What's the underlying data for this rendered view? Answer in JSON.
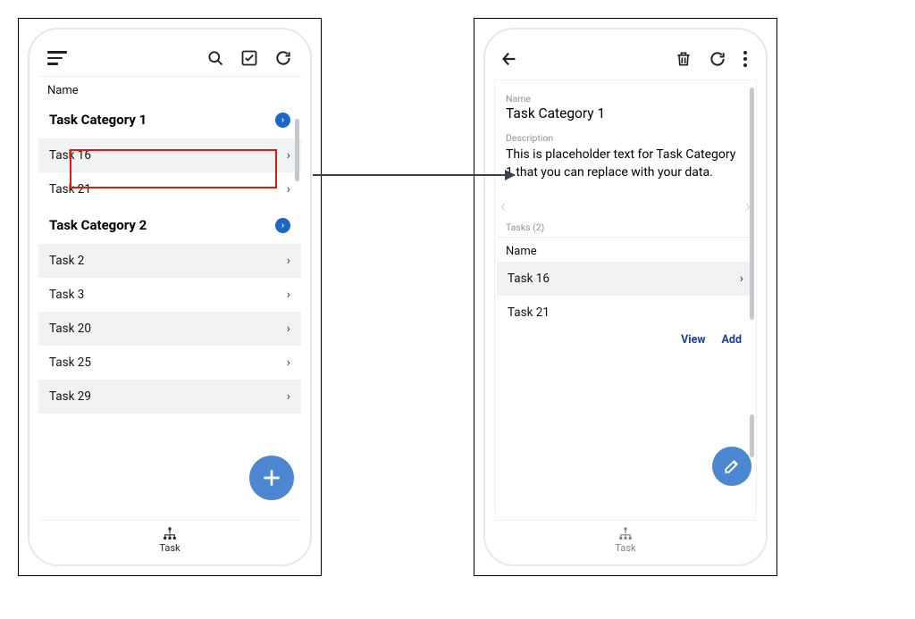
{
  "left": {
    "column_header": "Name",
    "categories": [
      {
        "label": "Task Category 1"
      },
      {
        "label": "Task Category 2"
      }
    ],
    "rows_cat1": [
      {
        "label": "Task 16"
      },
      {
        "label": "Task 21"
      }
    ],
    "rows_cat2": [
      {
        "label": "Task 2"
      },
      {
        "label": "Task 3"
      },
      {
        "label": "Task 20"
      },
      {
        "label": "Task 25"
      },
      {
        "label": "Task 29"
      }
    ],
    "bottom_tab": "Task"
  },
  "right": {
    "name_label": "Name",
    "name_value": "Task Category 1",
    "desc_label": "Description",
    "desc_value": "This is placeholder text for Task Category 1 that you can replace with your data.",
    "tasks_tab": "Tasks (2)",
    "column_header": "Name",
    "rows": [
      {
        "label": "Task 16"
      },
      {
        "label": "Task 21"
      }
    ],
    "view_label": "View",
    "add_label": "Add",
    "bottom_tab": "Task"
  }
}
